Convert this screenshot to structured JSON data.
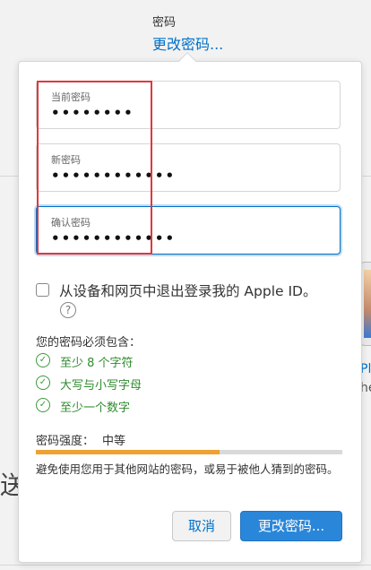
{
  "header": {
    "section_title": "密码",
    "change_link": "更改密码..."
  },
  "background": {
    "cut_char": "送",
    "device_text_1": "Pl",
    "device_text_2": "he"
  },
  "form": {
    "current_password": {
      "label": "当前密码",
      "value": "••••••••"
    },
    "new_password": {
      "label": "新密码",
      "value": "••••••••••••"
    },
    "confirm_password": {
      "label": "确认密码",
      "value": "••••••••••••"
    }
  },
  "signout_option": {
    "label": "从设备和网页中退出登录我的 Apple ID。",
    "checked": false,
    "help_glyph": "?"
  },
  "requirements": {
    "title": "您的密码必须包含：",
    "items": [
      {
        "text": "至少 8 个字符",
        "met": true
      },
      {
        "text": "大写与小写字母",
        "met": true
      },
      {
        "text": "至少一个数字",
        "met": true
      }
    ]
  },
  "strength": {
    "label": "密码强度：",
    "value": "中等",
    "level": 0.6,
    "advice": "避免使用您用于其他网站的密码，或易于被他人猜到的密码。"
  },
  "buttons": {
    "cancel": "取消",
    "submit": "更改密码..."
  },
  "colors": {
    "accent": "#0070c9",
    "annotation": "#e0383e",
    "requirement_met": "#2e8b2e",
    "strength_fill": "#f0a030"
  }
}
